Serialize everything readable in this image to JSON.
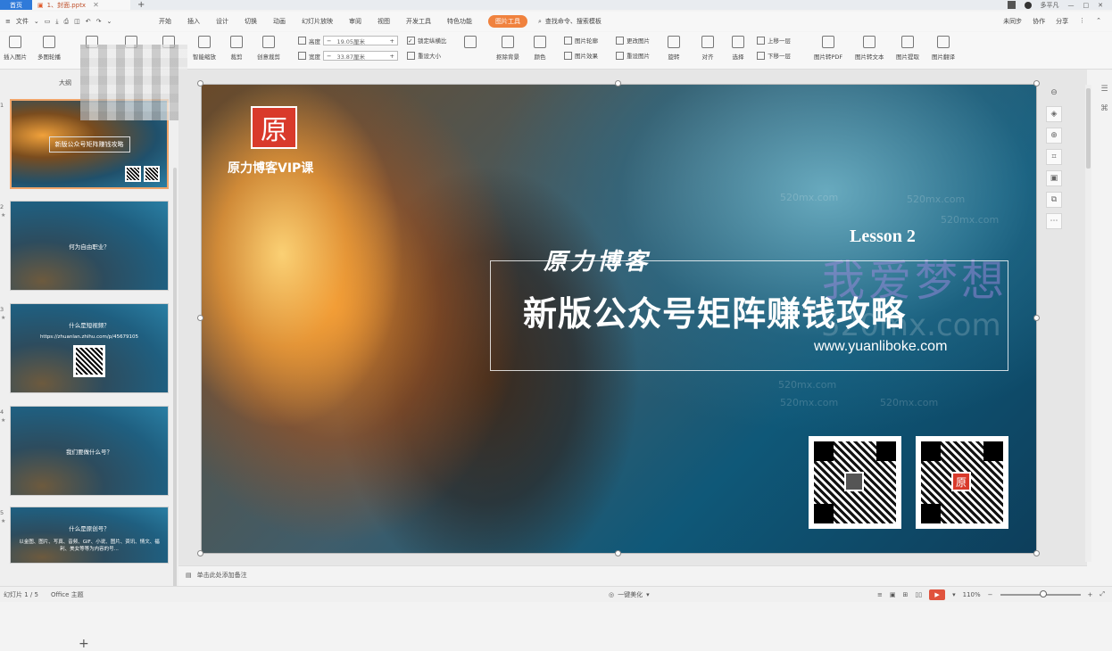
{
  "titlebar": {
    "home_tab": "首页",
    "doc_tab": "1、封面.pptx",
    "add_tab": "+",
    "user": "多平凡"
  },
  "menubar": {
    "file_label": "文件",
    "items": [
      "开始",
      "插入",
      "设计",
      "切换",
      "动画",
      "幻灯片放映",
      "审阅",
      "视图",
      "开发工具",
      "特色功能"
    ],
    "active_item": "图片工具",
    "search_label": "查找命令、搜索模板",
    "right_items": [
      "未同步",
      "协作",
      "分享"
    ]
  },
  "ribbon": {
    "buttons": [
      "插入图片",
      "多图轮播",
      "",
      "",
      "",
      "智能缩放",
      "裁剪",
      "创意裁剪",
      "",
      "",
      "",
      "",
      "抠除背景",
      "颜色",
      "图片轮廓",
      "更改图片",
      "图片效果",
      "重设图片",
      "旋转",
      "对齐",
      "组合",
      "选择",
      "上移一层",
      "下移一层",
      "图片转PDF",
      "图片转文本",
      "图片提取",
      "图片翻译"
    ],
    "height_label": "高度",
    "height_value": "19.05厘米",
    "width_label": "宽度",
    "width_value": "33.87厘米",
    "lock_ratio_label": "锁定纵横比",
    "reset_size_label": "重设大小"
  },
  "leftpane": {
    "tab_label": "大纲",
    "slides": [
      {
        "num": "1",
        "title": "新版公众号矩阵赚钱攻略",
        "lesson": "Lesson 2"
      },
      {
        "num": "2",
        "title": "何为自由职业？"
      },
      {
        "num": "3",
        "title": "什么是短视频？",
        "sub": "https://zhuanlan.zhihu.com/p/45679105"
      },
      {
        "num": "4",
        "title": "我们要做什么号？"
      },
      {
        "num": "5",
        "title": "什么是原创号？",
        "sub": "以金图、图片、写真、音频、GIF、小说、图片、资讯、情文、福利、美女等等为内容的号..."
      }
    ],
    "add_label": "+"
  },
  "slide": {
    "logo_char": "原",
    "logo_text": "原力博客VIP课",
    "calligraphy": "原力博客",
    "lesson": "Lesson 2",
    "title": "新版公众号矩阵赚钱攻略",
    "url": "www.yuanliboke.com",
    "watermark_cn": "我爱梦想",
    "watermark_en": "520mx.com",
    "watermark_small": "520mx.com"
  },
  "notes": {
    "placeholder": "单击此处添加备注"
  },
  "statusbar": {
    "slide_counter": "幻灯片 1 / 5",
    "theme": "Office 主题",
    "beautify": "一键美化",
    "zoom": "110%",
    "zoom_minus": "−",
    "zoom_plus": "+",
    "play": "▶"
  }
}
